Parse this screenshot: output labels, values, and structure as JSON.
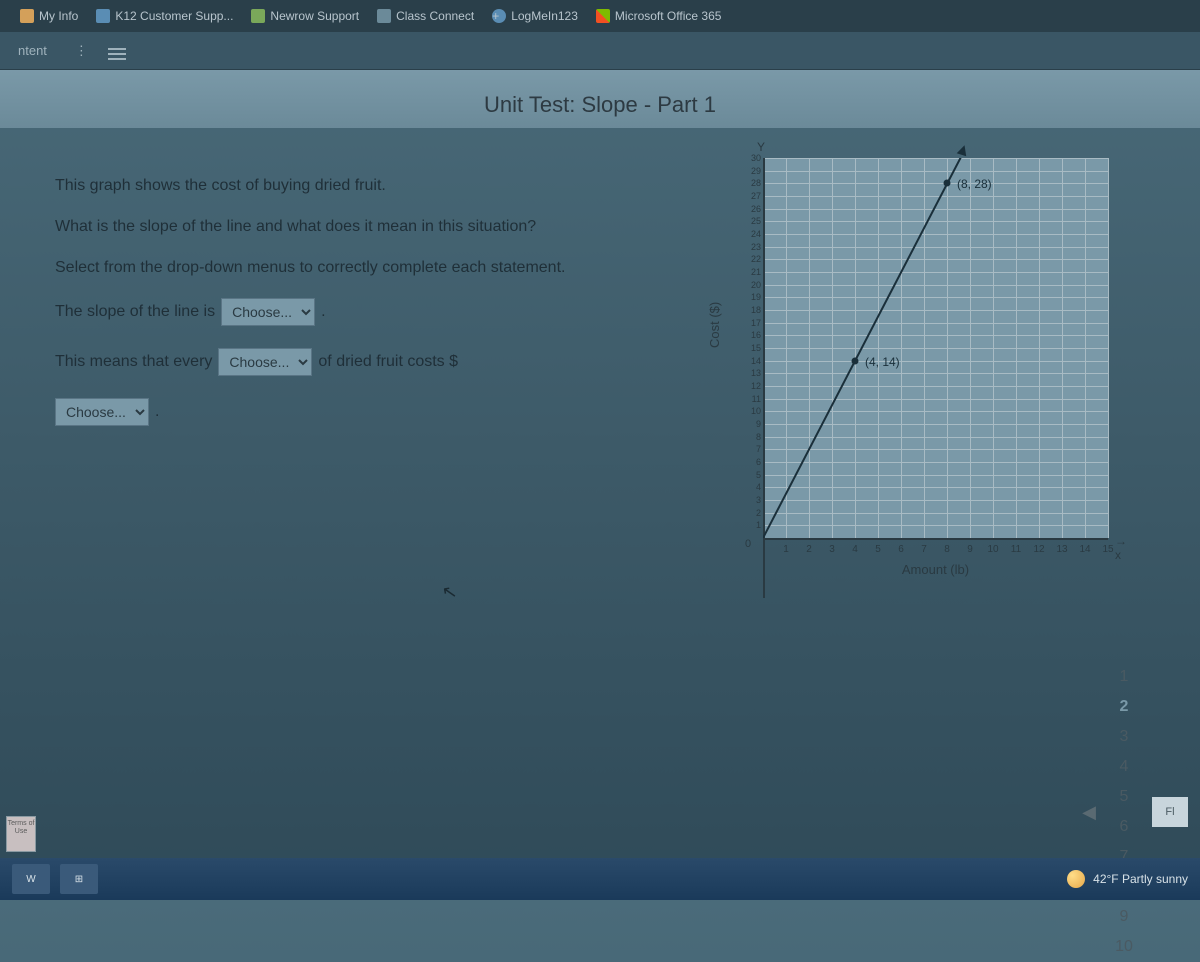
{
  "bookmarks": [
    {
      "label": "My Info",
      "icon": "orange"
    },
    {
      "label": "K12 Customer Supp...",
      "icon": "blue"
    },
    {
      "label": "Newrow Support",
      "icon": "green"
    },
    {
      "label": "Class Connect",
      "icon": "gray"
    },
    {
      "label": "LogMeIn123",
      "icon": "blue"
    },
    {
      "label": "Microsoft Office 365",
      "icon": "ms"
    }
  ],
  "tab": {
    "label": "ntent"
  },
  "page_title": "Unit Test: Slope - Part 1",
  "question": {
    "intro": "This graph shows the cost of buying dried fruit.",
    "prompt": "What is the slope of the line and what does it mean in this situation?",
    "instruct": "Select from the drop-down menus to correctly complete each statement.",
    "stmt1_pre": "The slope of the line is",
    "stmt2_pre": "This means that every",
    "stmt2_post": "of dried fruit costs $",
    "choose_label": "Choose..."
  },
  "chart_data": {
    "type": "line",
    "title": "",
    "xlabel": "Amount (lb)",
    "ylabel": "Cost ($)",
    "x_axis_letter": "x",
    "y_axis_letter": "Y",
    "xlim": [
      0,
      15
    ],
    "ylim": [
      0,
      30
    ],
    "x_ticks": [
      1,
      2,
      3,
      4,
      5,
      6,
      7,
      8,
      9,
      10,
      11,
      12,
      13,
      14,
      15
    ],
    "y_ticks": [
      1,
      2,
      3,
      4,
      5,
      6,
      7,
      8,
      9,
      10,
      11,
      12,
      13,
      14,
      15,
      16,
      17,
      18,
      19,
      20,
      21,
      22,
      23,
      24,
      25,
      26,
      27,
      28,
      29,
      30
    ],
    "series": [
      {
        "name": "cost",
        "x": [
          0,
          4,
          8
        ],
        "y": [
          0,
          14,
          28
        ],
        "labeled_points": [
          {
            "x": 4,
            "y": 14,
            "label": "(4, 14)"
          },
          {
            "x": 8,
            "y": 28,
            "label": "(8, 28)"
          }
        ]
      }
    ]
  },
  "pager": {
    "pages": [
      "1",
      "2",
      "3",
      "4",
      "5",
      "6",
      "7",
      "8",
      "9",
      "10"
    ],
    "current": "2",
    "flag": "Fl"
  },
  "taskbar": {
    "terms": "Terms of Use",
    "weather": "42°F Partly sunny"
  }
}
